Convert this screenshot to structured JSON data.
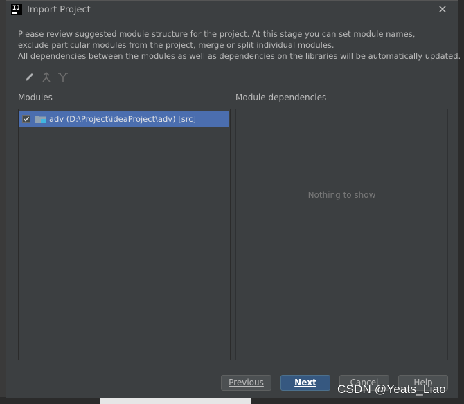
{
  "window": {
    "title": "Import Project"
  },
  "description": [
    "Please review suggested module structure for the project. At this stage you can set module names,",
    "exclude particular modules from the project, merge or split individual modules.",
    "All dependencies between the modules as well as dependencies on the libraries will be automatically updated."
  ],
  "toolbar": {
    "icons": [
      "edit-pencil-icon",
      "merge-icon",
      "split-icon"
    ]
  },
  "modules": {
    "label": "Modules",
    "items": [
      {
        "checked": true,
        "text": "adv (D:\\Project\\ideaProject\\adv) [src]"
      }
    ]
  },
  "dependencies": {
    "label": "Module dependencies",
    "empty_text": "Nothing to show"
  },
  "buttons": {
    "previous": "Previous",
    "next": "Next",
    "cancel": "Cancel",
    "help": "Help"
  },
  "watermark": "CSDN @Yeats_Liao",
  "colors": {
    "dialog_bg": "#3c3f41",
    "selection": "#4b6eaf",
    "primary_button": "#365880"
  }
}
